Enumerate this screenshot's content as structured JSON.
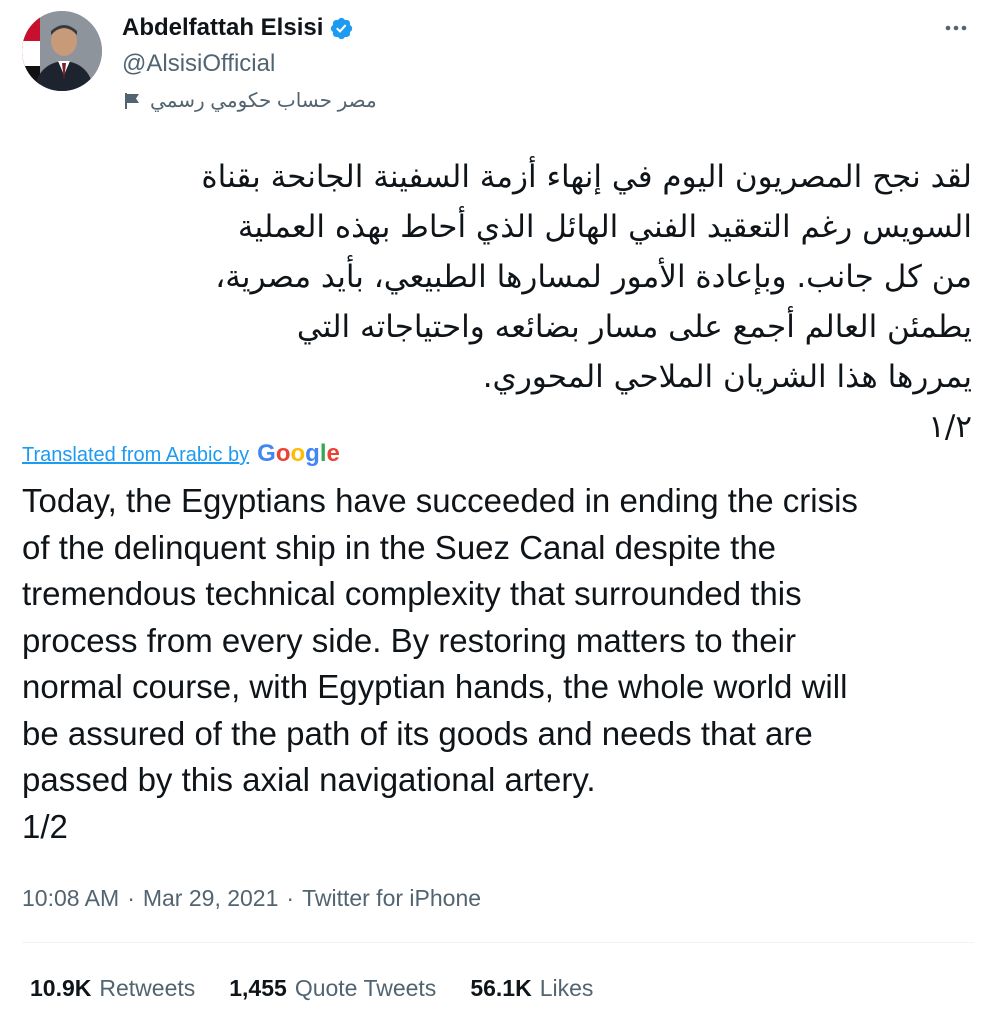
{
  "author": {
    "display_name": "Abdelfattah Elsisi",
    "handle": "@AlsisiOfficial",
    "label": "مصر حساب حكومي رسمي",
    "verified": true
  },
  "icons": {
    "verified": "verified-badge-icon",
    "flag": "flag-icon",
    "more": "more-options-icon",
    "avatar": "profile-photo"
  },
  "tweet": {
    "arabic_text": "لقد نجح المصريون اليوم في إنهاء أزمة السفينة الجانحة بقناة\nالسويس رغم التعقيد الفني الهائل الذي أحاط بهذه العملية\nمن كل جانب. وبإعادة الأمور لمسارها الطبيعي، بأيد مصرية،\nيطمئن العالم أجمع على مسار بضائعه واحتياجاته التي\nيمررها هذا الشريان الملاحي المحوري.\n١/٢",
    "translated_label": "Translated from Arabic by",
    "translation_provider": "Google",
    "english_text": "Today, the Egyptians have succeeded in ending the crisis\nof the delinquent ship in the Suez Canal despite the\ntremendous technical complexity that surrounded this\nprocess from every side. By restoring matters to their\nnormal course, with Egyptian hands, the whole world will\nbe assured of the path of its goods and needs that are\npassed by this axial navigational artery.\n 1/2"
  },
  "meta": {
    "time": "10:08 AM",
    "separator": "·",
    "date": "Mar 29, 2021",
    "source": "Twitter for iPhone"
  },
  "stats": {
    "retweets_count": "10.9K",
    "retweets_label": "Retweets",
    "quotes_count": "1,455",
    "quotes_label": "Quote Tweets",
    "likes_count": "56.1K",
    "likes_label": "Likes"
  },
  "colors": {
    "accent": "#1d9bf0",
    "secondary_text": "#536471",
    "primary_text": "#0f1419",
    "google_blue": "#4285f4",
    "google_red": "#ea4335",
    "google_yellow": "#fbbc05",
    "google_green": "#34a853"
  }
}
